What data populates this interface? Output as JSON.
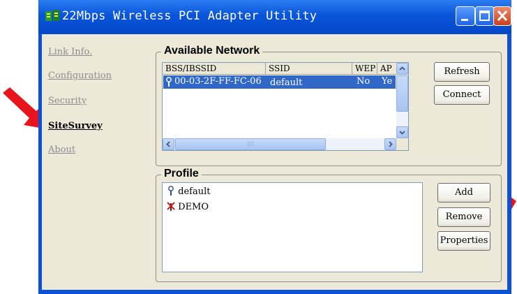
{
  "window": {
    "title": "22Mbps Wireless PCI Adapter Utility"
  },
  "nav": {
    "items": [
      {
        "label": "Link Info."
      },
      {
        "label": "Configuration"
      },
      {
        "label": "Security"
      },
      {
        "label": "SiteSurvey"
      },
      {
        "label": "About"
      }
    ]
  },
  "available_network": {
    "title": "Available Network",
    "columns": [
      "BSS/IBSSID",
      "SSID",
      "WEP",
      "AP"
    ],
    "rows": [
      {
        "bssid": "00-03-2F-FF-FC-06",
        "ssid": "default",
        "wep": "No",
        "ap": "Ye"
      }
    ],
    "scroll_thumb_glyph": "III",
    "buttons": {
      "refresh": "Refresh",
      "connect": "Connect"
    }
  },
  "profile": {
    "title": "Profile",
    "items": [
      {
        "name": "default"
      },
      {
        "name": "DEMO"
      }
    ],
    "buttons": {
      "add": "Add",
      "remove": "Remove",
      "properties": "Properties"
    }
  },
  "colors": {
    "selection": "#3168c8",
    "titlebar": "#0a55da",
    "annotation_arrow": "#e8131b"
  }
}
